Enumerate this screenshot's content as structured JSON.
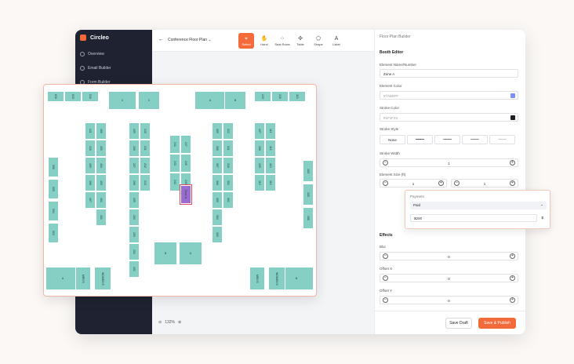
{
  "sidebar": {
    "brand": "Circleo",
    "items": [
      {
        "label": "Overview"
      },
      {
        "label": "Email Builder"
      },
      {
        "label": "Form Builder"
      }
    ]
  },
  "topbar": {
    "back": "←",
    "title": "Conference Floor Plan",
    "chevron": "⌄",
    "tools": [
      {
        "label": "Select",
        "icon": "cursor-icon",
        "glyph": "⌖",
        "active": true
      },
      {
        "label": "Hand",
        "icon": "hand-icon",
        "glyph": "✋"
      },
      {
        "label": "Seat Rows",
        "icon": "seat-rows-icon",
        "glyph": "⁘"
      },
      {
        "label": "Table",
        "icon": "table-icon",
        "glyph": "✣"
      },
      {
        "label": "Shape",
        "icon": "shape-icon",
        "glyph": "⬠"
      },
      {
        "label": "Label",
        "icon": "label-icon",
        "glyph": "A"
      }
    ]
  },
  "zoom": {
    "minus": "⊖",
    "value": "132%",
    "plus": "⊕"
  },
  "panel": {
    "title": "Floor Plan Builder",
    "section": "Booth Editor",
    "name_label": "Element Name/Number",
    "name_value": "Zone A",
    "color_label": "Element Color",
    "color_value": "#7A8EFF",
    "color_hex": "#7a8eff",
    "stroke_label": "Stroke Color",
    "stroke_value": "#1F1F23",
    "stroke_hex": "#1f1f23",
    "style_label": "Stroke Style",
    "styles": [
      "None",
      "━━━━",
      "╍╍╍╍",
      "┅┅┅┅",
      "┈┈┈┈"
    ],
    "width_label": "Stroke Width",
    "width_value": "1",
    "size_label": "Element Size (ft)",
    "size_w": "1",
    "size_h": "1",
    "effects": "Effects",
    "blur_label": "Blur",
    "blur_value": "0",
    "ox_label": "Offset X",
    "ox_value": "0",
    "oy_label": "Offset Y",
    "oy_value": "0",
    "save_draft": "Save Draft",
    "publish": "Save & Publish"
  },
  "payment": {
    "title": "Payment",
    "status": "Paid",
    "amount": "$200",
    "currency": "$"
  },
  "booths": {
    "top_left": [
      "610",
      "613",
      "510"
    ],
    "top_right": [
      "213",
      "216",
      "113"
    ],
    "c_left": "C",
    "c_right": "C",
    "a": "A",
    "b_bottom": "B",
    "a_bottom": "A",
    "b_left": "B",
    "left": [
      "506",
      "505",
      "504",
      "503"
    ],
    "right": [
      "103",
      "105",
      "106"
    ],
    "mens": "MEN'S",
    "womens": "WOMEN'S",
    "col1": [
      "411",
      "410",
      "409",
      "408",
      "407"
    ],
    "col2": [
      "406",
      "405",
      "404",
      "403",
      "402",
      "401"
    ],
    "col3": [
      "309",
      "308",
      "307",
      "306",
      "305",
      "304",
      "303"
    ],
    "col4": [
      "312",
      "311",
      "310",
      "302",
      "301"
    ],
    "col5": [
      "209",
      "208",
      "207",
      "206",
      "205",
      "204",
      "203",
      "202",
      "201"
    ],
    "col6": [
      "210",
      "211",
      "212",
      "213"
    ],
    "col7": [
      "107",
      "108",
      "109",
      "110"
    ],
    "col8": [
      "111",
      "112",
      "113",
      "114"
    ],
    "center1": [
      "244",
      "243",
      "242"
    ],
    "center2": [
      "247",
      "246",
      "245"
    ],
    "selected": "Zone A"
  }
}
